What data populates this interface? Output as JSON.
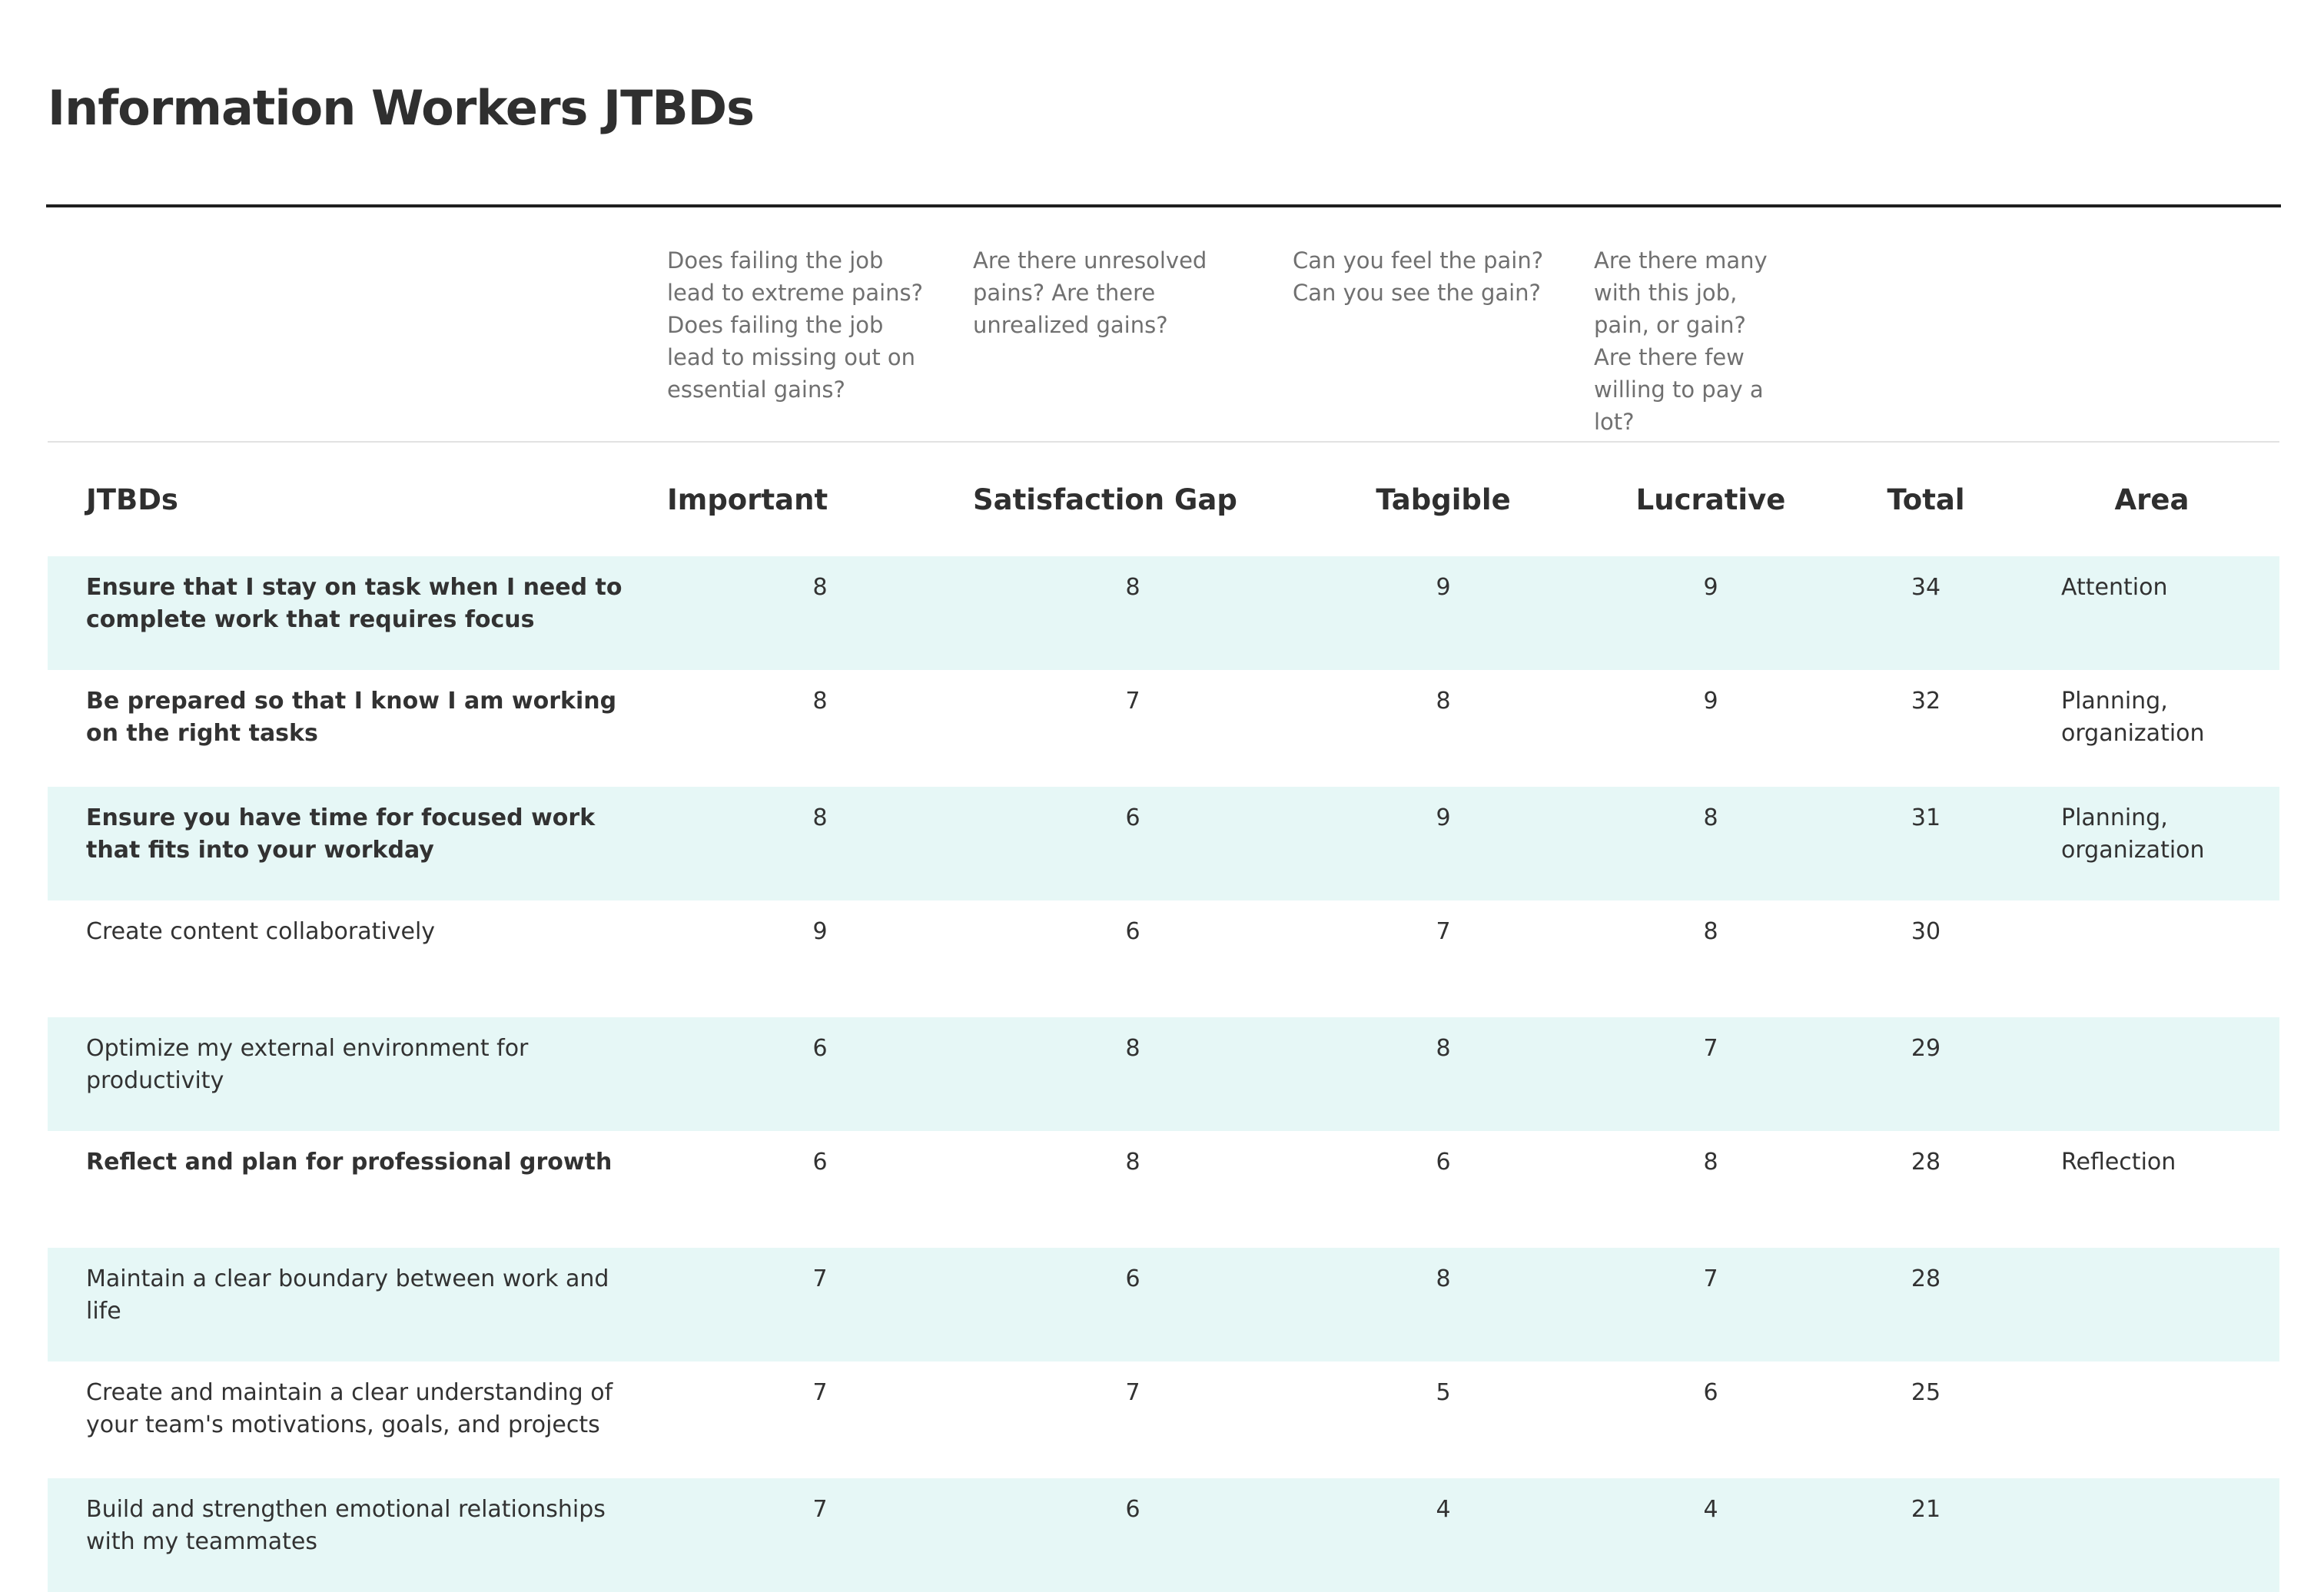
{
  "title": "Information Workers JTBDs",
  "questions": {
    "important": "Does failing the job lead to extreme pains? Does failing the job lead to missing out on essential gains?",
    "satisfaction_gap": "Are there unresolved pains? Are there unrealized gains?",
    "tangible": "Can you feel the pain? Can you see the gain?",
    "lucrative": "Are there many with this job, pain, or gain? Are there few willing to pay a lot?"
  },
  "headers": {
    "jtbds": "JTBDs",
    "important": "Important",
    "satisfaction_gap": "Satisfaction Gap",
    "tangible": "Tabgible",
    "lucrative": "Lucrative",
    "total": "Total",
    "area": "Area"
  },
  "rows": [
    {
      "jtbd": "Ensure that I stay on task when I need to complete work that requires focus",
      "bold": true,
      "important": "8",
      "satisfaction_gap": "8",
      "tangible": "9",
      "lucrative": "9",
      "total": "34",
      "area": "Attention"
    },
    {
      "jtbd": "Be prepared so that I know I am working on the right tasks",
      "bold": true,
      "important": "8",
      "satisfaction_gap": "7",
      "tangible": "8",
      "lucrative": "9",
      "total": "32",
      "area": "Planning, organization"
    },
    {
      "jtbd": "Ensure you have time for focused work that fits into your workday",
      "bold": true,
      "important": "8",
      "satisfaction_gap": "6",
      "tangible": "9",
      "lucrative": "8",
      "total": "31",
      "area": "Planning, organization"
    },
    {
      "jtbd": "Create content collaboratively",
      "bold": false,
      "important": "9",
      "satisfaction_gap": "6",
      "tangible": "7",
      "lucrative": "8",
      "total": "30",
      "area": ""
    },
    {
      "jtbd": "Optimize my external environment for productivity",
      "bold": false,
      "important": "6",
      "satisfaction_gap": "8",
      "tangible": "8",
      "lucrative": "7",
      "total": "29",
      "area": ""
    },
    {
      "jtbd": "Reflect and plan for professional growth",
      "bold": true,
      "important": "6",
      "satisfaction_gap": "8",
      "tangible": "6",
      "lucrative": "8",
      "total": "28",
      "area": "Reflection"
    },
    {
      "jtbd": "Maintain a clear boundary between work and life",
      "bold": false,
      "important": "7",
      "satisfaction_gap": "6",
      "tangible": "8",
      "lucrative": "7",
      "total": "28",
      "area": ""
    },
    {
      "jtbd": "Create and maintain a clear understanding of your team's motivations, goals, and projects",
      "bold": false,
      "important": "7",
      "satisfaction_gap": "7",
      "tangible": "5",
      "lucrative": "6",
      "total": "25",
      "area": ""
    },
    {
      "jtbd": "Build and strengthen emotional relationships with my teammates",
      "bold": false,
      "important": "7",
      "satisfaction_gap": "6",
      "tangible": "4",
      "lucrative": "4",
      "total": "21",
      "area": ""
    }
  ]
}
